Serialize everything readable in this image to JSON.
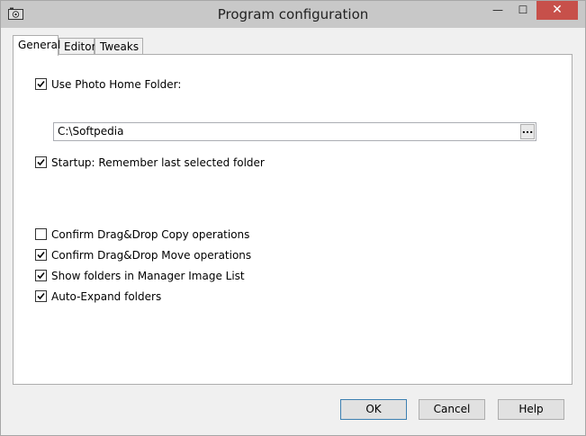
{
  "window": {
    "title": "Program configuration",
    "controls": {
      "minimize": "—",
      "maximize": "☐",
      "close": "✕"
    },
    "icon": "camera-icon"
  },
  "tabs": [
    {
      "label": "General",
      "active": true
    },
    {
      "label": "Editor",
      "active": false
    },
    {
      "label": "Tweaks",
      "active": false
    }
  ],
  "general": {
    "use_home_folder": {
      "label": "Use Photo Home Folder:",
      "checked": true
    },
    "home_folder_path": "C:\\Softpedia",
    "browse_label": "...",
    "startup_remember": {
      "label": "Startup: Remember last selected folder",
      "checked": true
    },
    "confirm_copy": {
      "label": "Confirm Drag&Drop Copy operations",
      "checked": false
    },
    "confirm_move": {
      "label": "Confirm Drag&Drop Move operations",
      "checked": true
    },
    "show_folders": {
      "label": "Show folders in Manager Image List",
      "checked": true
    },
    "auto_expand": {
      "label": "Auto-Expand folders",
      "checked": true
    }
  },
  "buttons": {
    "ok": "OK",
    "cancel": "Cancel",
    "help": "Help"
  }
}
